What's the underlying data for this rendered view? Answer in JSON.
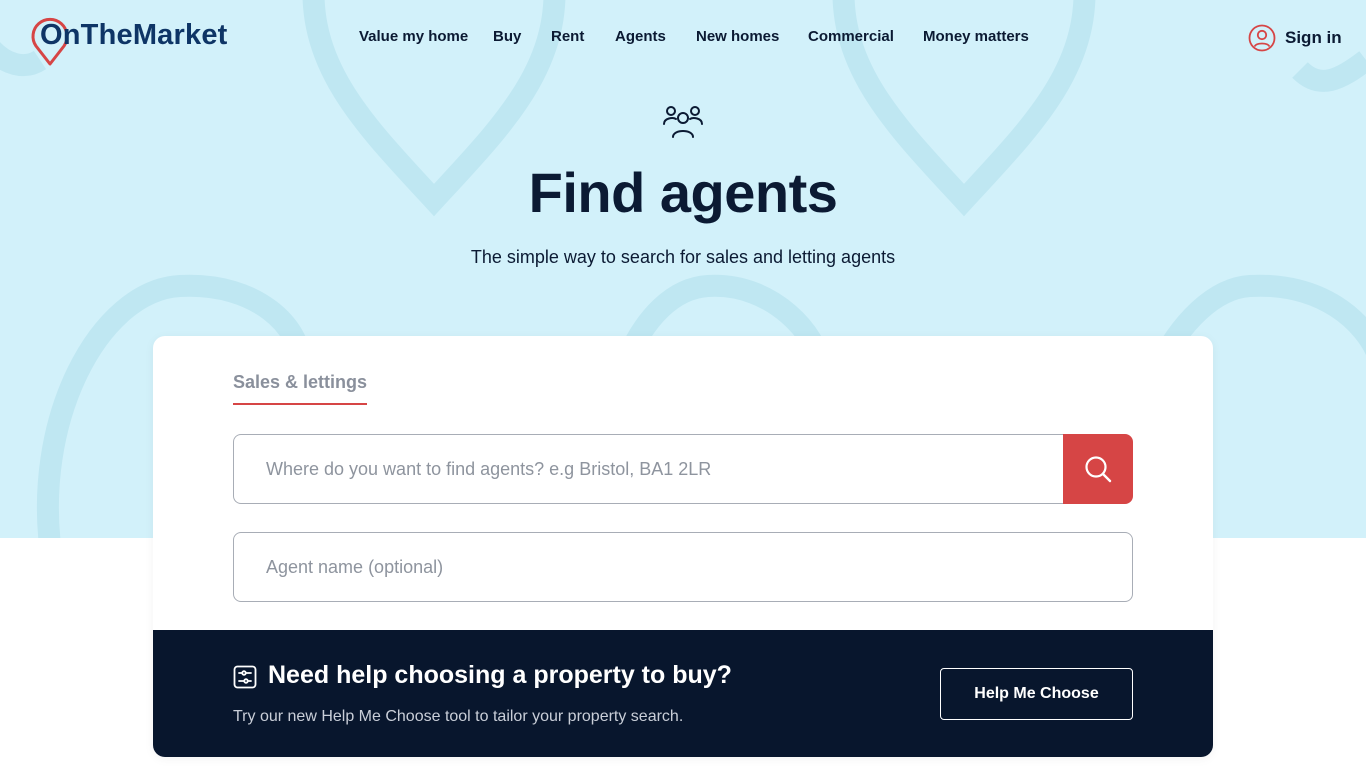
{
  "brand": {
    "name": "OnTheMarket",
    "accent": "#d64545",
    "navy": "#0e3566",
    "hero_bg": "#d2f1fa"
  },
  "nav": {
    "items": [
      {
        "label": "Value my home",
        "name": "nav-value-my-home"
      },
      {
        "label": "Buy",
        "name": "nav-buy"
      },
      {
        "label": "Rent",
        "name": "nav-rent"
      },
      {
        "label": "Agents",
        "name": "nav-agents"
      },
      {
        "label": "New homes",
        "name": "nav-new-homes"
      },
      {
        "label": "Commercial",
        "name": "nav-commercial"
      },
      {
        "label": "Money matters",
        "name": "nav-money-matters"
      }
    ],
    "signin_label": "Sign in"
  },
  "hero": {
    "icon": "people-group-icon",
    "title": "Find agents",
    "subtitle": "The simple way to search for sales and letting agents"
  },
  "search": {
    "tab_label": "Sales & lettings",
    "location_placeholder": "Where do you want to find agents? e.g Bristol, BA1 2LR",
    "location_value": "",
    "agent_placeholder": "Agent name (optional)",
    "agent_value": "",
    "search_icon": "search-icon"
  },
  "banner": {
    "icon": "sliders-icon",
    "title": "Need help choosing a property to buy?",
    "text": "Try our new Help Me Choose tool to tailor your property search.",
    "button_label": "Help Me Choose"
  }
}
